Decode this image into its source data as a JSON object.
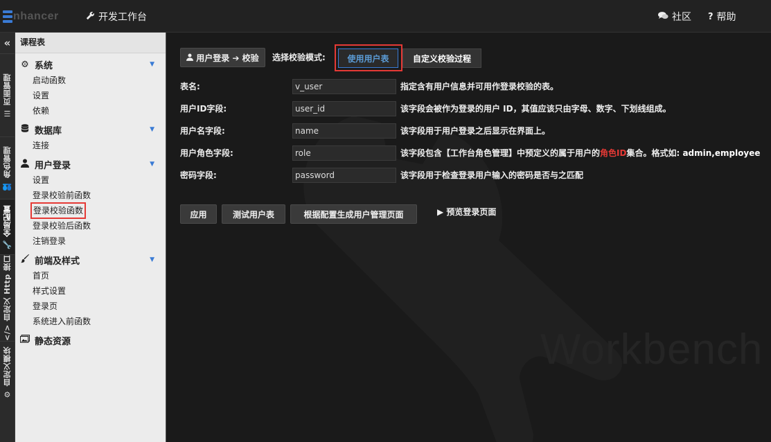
{
  "header": {
    "logo_text": "nhancer",
    "workbench_label": "开发工作台",
    "community_label": "社区",
    "help_label": "帮助"
  },
  "vertical_tabs": [
    {
      "label": "页面管理"
    },
    {
      "label": "角色管理"
    },
    {
      "label": "全局配置"
    },
    {
      "label": "自定义 Http 接口"
    },
    {
      "label": "自定义模块"
    }
  ],
  "sidebar": {
    "title": "课程表",
    "groups": [
      {
        "label": "系统",
        "items": [
          "启动函数",
          "设置",
          "依赖"
        ]
      },
      {
        "label": "数据库",
        "items": [
          "连接"
        ]
      },
      {
        "label": "用户登录",
        "items": [
          "设置",
          "登录校验前函数",
          "登录校验函数",
          "登录校验后函数",
          "注销登录"
        ]
      },
      {
        "label": "前端及样式",
        "items": [
          "首页",
          "样式设置",
          "登录页",
          "系统进入前函数"
        ]
      },
      {
        "label": "静态资源",
        "items": []
      }
    ]
  },
  "main": {
    "breadcrumb_a": "用户登录",
    "breadcrumb_b": "校验",
    "mode_label": "选择校验模式:",
    "tab_use_table": "使用用户表",
    "tab_custom": "自定义校验过程",
    "fields": [
      {
        "label": "表名:",
        "value": "v_user",
        "desc": "指定含有用户信息并可用作登录校验的表。"
      },
      {
        "label": "用户ID字段:",
        "value": "user_id",
        "desc": "该字段会被作为登录的用户 ID，其值应该只由字母、数字、下划线组成。"
      },
      {
        "label": "用户名字段:",
        "value": "name",
        "desc": "该字段用于用户登录之后显示在界面上。"
      },
      {
        "label": "用户角色字段:",
        "value": "role",
        "desc_pre": "该字段包含【工作台角色管理】中预定义的属于用户的",
        "desc_red": "角色ID",
        "desc_mid": "集合。格式如: ",
        "desc_bold": "admin,employee"
      },
      {
        "label": "密码字段:",
        "value": "password",
        "desc": "该字段用于检查登录用户输入的密码是否与之匹配"
      }
    ],
    "actions": {
      "apply": "应用",
      "test": "测试用户表",
      "generate": "根据配置生成用户管理页面",
      "preview": "预览登录页面"
    },
    "watermark": "Workbench"
  },
  "colors": {
    "accent": "#3a7bd5",
    "highlight": "#e53935"
  }
}
